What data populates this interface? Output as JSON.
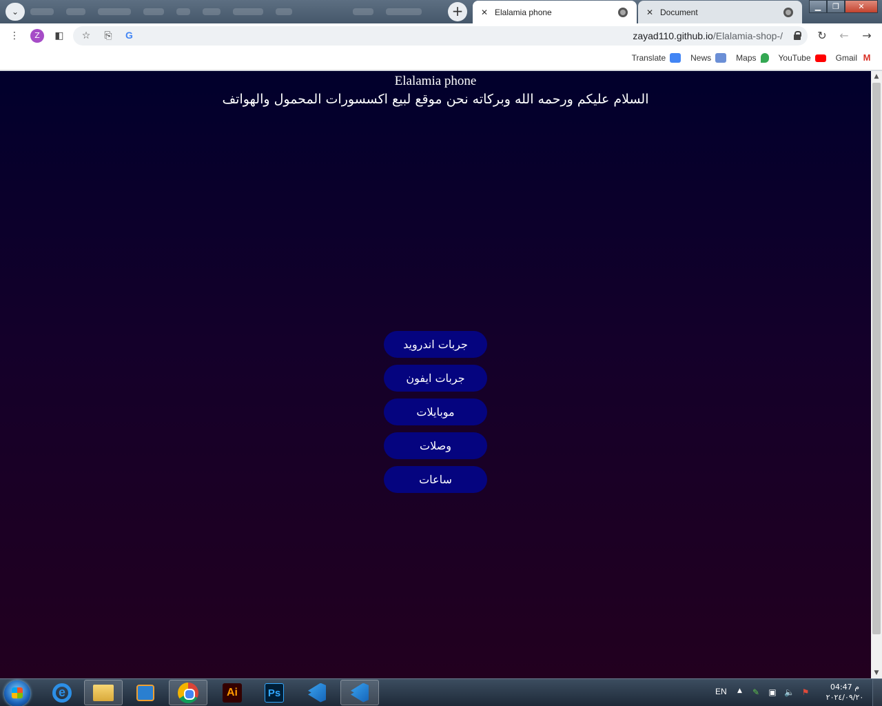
{
  "browser": {
    "tabs": [
      {
        "title": "Elalamia phone",
        "active": true
      },
      {
        "title": "Document",
        "active": false
      }
    ],
    "profile_initial": "Z",
    "url_host": "zayad110.github.io",
    "url_path": "/Elalamia-shop-/",
    "bookmarks": [
      {
        "label": "Translate",
        "icon": "translate-icon",
        "color": "#4285f4"
      },
      {
        "label": "News",
        "icon": "news-icon",
        "color": "#6b8fd6"
      },
      {
        "label": "Maps",
        "icon": "maps-icon",
        "color": "#34a853"
      },
      {
        "label": "YouTube",
        "icon": "youtube-icon",
        "color": "#ff0000"
      },
      {
        "label": "Gmail",
        "icon": "gmail-icon",
        "color": "#d93025"
      }
    ]
  },
  "page": {
    "title": "Elalamia phone",
    "subtitle": "السلام عليكم ورحمه الله وبركاته نحن موقع لبيع اكسسورات المحمول والهواتف",
    "menu": [
      {
        "label": "جربات اندرويد"
      },
      {
        "label": "جربات ايفون"
      },
      {
        "label": "موبايلات"
      },
      {
        "label": "وصلات"
      },
      {
        "label": "ساعات"
      }
    ],
    "colors": {
      "background_top": "#01002c",
      "background_bottom": "#22001f",
      "button": "#05047f",
      "text": "#ffffff"
    }
  },
  "taskbar": {
    "language": "EN",
    "time": "04:47 م",
    "date": "٢٠٢٤/٠٩/٢٠",
    "apps": [
      "internet-explorer-icon",
      "file-explorer-icon",
      "media-player-icon",
      "chrome-icon",
      "illustrator-icon",
      "photoshop-icon",
      "vscode-icon",
      "vscode-icon"
    ]
  }
}
